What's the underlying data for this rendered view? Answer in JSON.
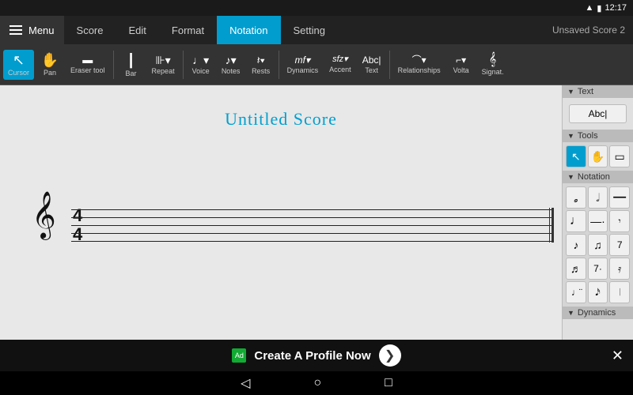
{
  "statusBar": {
    "time": "12:17",
    "batteryIcon": "🔋",
    "wifiIcon": "▲"
  },
  "menuBar": {
    "hamburgerLabel": "Menu",
    "items": [
      {
        "id": "score",
        "label": "Score",
        "active": false
      },
      {
        "id": "edit",
        "label": "Edit",
        "active": false
      },
      {
        "id": "format",
        "label": "Format",
        "active": false
      },
      {
        "id": "notation",
        "label": "Notation",
        "active": true
      },
      {
        "id": "setting",
        "label": "Setting",
        "active": false
      }
    ],
    "titleRight": "Unsaved Score 2"
  },
  "toolbar": {
    "tools": [
      {
        "id": "cursor",
        "icon": "↖",
        "label": "Cursor",
        "active": true
      },
      {
        "id": "pan",
        "icon": "✋",
        "label": "Pan",
        "active": false
      },
      {
        "id": "eraser",
        "icon": "⬜",
        "label": "Eraser tool",
        "active": false
      },
      {
        "id": "bar",
        "icon": "|",
        "label": "Bar",
        "active": false
      },
      {
        "id": "repeat",
        "icon": "⊪",
        "label": "Repeat",
        "active": false
      },
      {
        "id": "voice",
        "icon": "♩",
        "label": "Voice",
        "active": false
      },
      {
        "id": "notes",
        "icon": "♪",
        "label": "Notes",
        "active": false
      },
      {
        "id": "rests",
        "icon": "𝄽",
        "label": "Rests",
        "active": false
      },
      {
        "id": "dynamics",
        "icon": "mf",
        "label": "Dynamics",
        "active": false
      },
      {
        "id": "accent",
        "icon": "sfz",
        "label": "Accent",
        "active": false
      },
      {
        "id": "text",
        "icon": "Abc|",
        "label": "Text",
        "active": false
      },
      {
        "id": "relationships",
        "icon": "⌒",
        "label": "Relationships",
        "active": false
      },
      {
        "id": "volta",
        "icon": "⌐",
        "label": "Volta",
        "active": false
      },
      {
        "id": "signature",
        "icon": "𝄞",
        "label": "Signat.",
        "active": false
      }
    ]
  },
  "score": {
    "title": "Untitled Score"
  },
  "rightPanel": {
    "textSection": {
      "label": "Text"
    },
    "textBtn": {
      "label": "Abc|"
    },
    "toolsSection": {
      "label": "Tools"
    },
    "tools": [
      {
        "id": "cursor-tool",
        "icon": "↖",
        "active": true
      },
      {
        "id": "pan-tool",
        "icon": "✋",
        "active": false
      },
      {
        "id": "eraser-tool",
        "icon": "▭",
        "active": false
      }
    ],
    "notationSection": {
      "label": "Notation"
    },
    "notationItems": [
      {
        "id": "n1",
        "icon": "𝅗"
      },
      {
        "id": "n2",
        "icon": "𝅗𝅥"
      },
      {
        "id": "n3",
        "icon": "—"
      },
      {
        "id": "n4",
        "icon": "𝅘𝅥"
      },
      {
        "id": "n5",
        "icon": "—"
      },
      {
        "id": "n6",
        "icon": "·"
      },
      {
        "id": "n7",
        "icon": "♩"
      },
      {
        "id": "n8",
        "icon": "♪"
      },
      {
        "id": "n9",
        "icon": "7"
      },
      {
        "id": "n10",
        "icon": "♫"
      },
      {
        "id": "n11",
        "icon": "7"
      },
      {
        "id": "n12",
        "icon": "·"
      },
      {
        "id": "n13",
        "icon": "𝅘𝅥𝅯"
      },
      {
        "id": "n14",
        "icon": "♬"
      },
      {
        "id": "n15",
        "icon": "𝅘𝅥𝅰"
      }
    ],
    "dynamicsSection": {
      "label": "Dynamics"
    }
  },
  "adBanner": {
    "text": "Create A Profile Now",
    "arrowIcon": "❯",
    "closeIcon": "✕"
  },
  "androidNav": {
    "backIcon": "◁",
    "homeIcon": "○",
    "recentIcon": "□"
  }
}
